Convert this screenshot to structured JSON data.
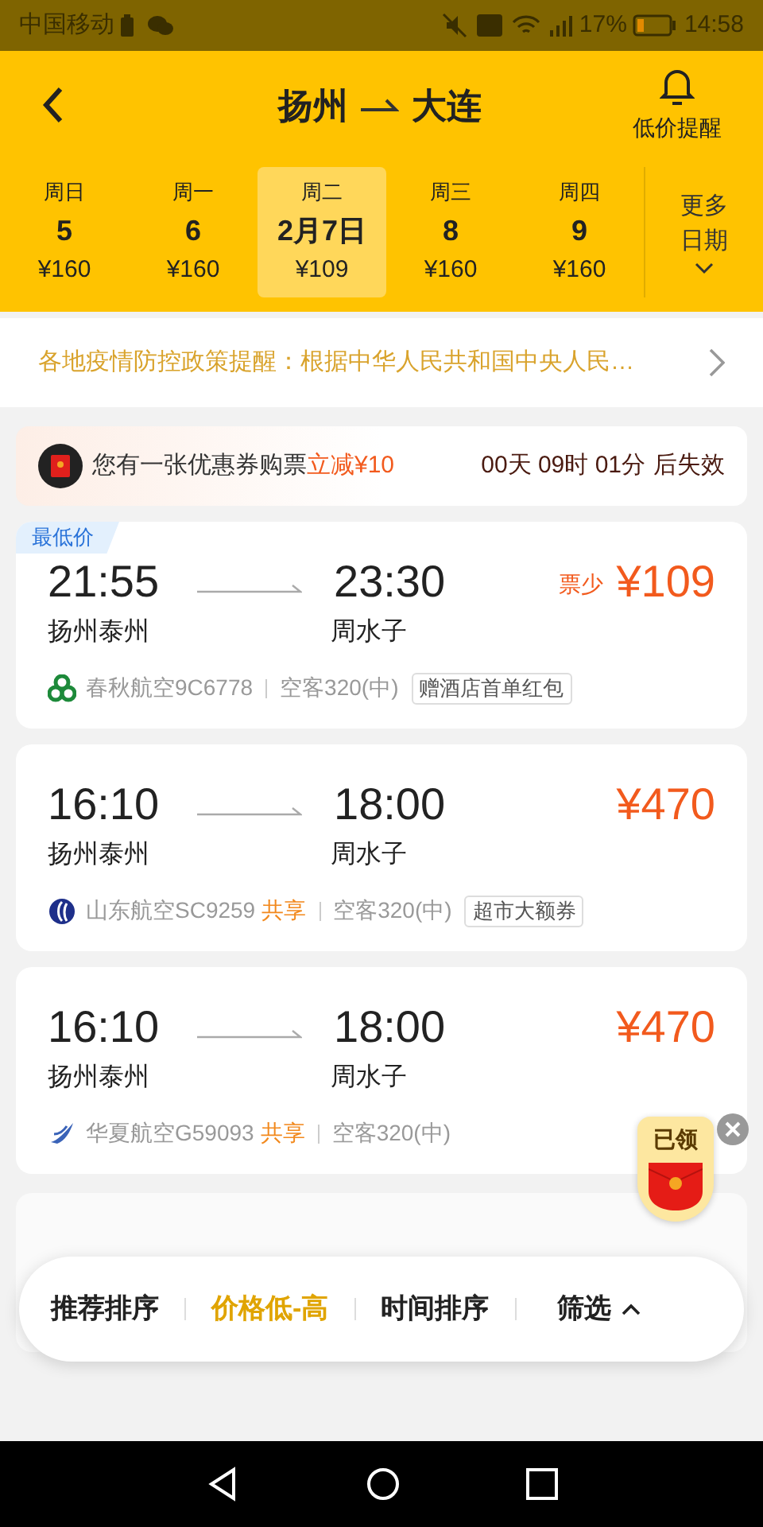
{
  "status_bar": {
    "carrier": "中国移动",
    "battery": "17%",
    "time": "14:58"
  },
  "header": {
    "from": "扬州",
    "to": "大连",
    "alert_label": "低价提醒"
  },
  "dates": [
    {
      "weekday": "周日",
      "day": "5",
      "price": "¥160",
      "selected": false
    },
    {
      "weekday": "周一",
      "day": "6",
      "price": "¥160",
      "selected": false
    },
    {
      "weekday": "周二",
      "day": "2月7日",
      "price": "¥109",
      "selected": true
    },
    {
      "weekday": "周三",
      "day": "8",
      "price": "¥160",
      "selected": false
    },
    {
      "weekday": "周四",
      "day": "9",
      "price": "¥160",
      "selected": false
    }
  ],
  "more_dates": "更多日期",
  "notice": "各地疫情防控政策提醒：根据中华人民共和国中央人民…",
  "coupon": {
    "text": "您有一张优惠券购票",
    "discount": "立减¥10",
    "countdown": "00天 09时 01分",
    "suffix": "后失效"
  },
  "flights": [
    {
      "badge": "最低价",
      "depart": "21:55",
      "arrive": "23:30",
      "from": "扬州泰州",
      "to": "周水子",
      "price_note": "票少",
      "price": "¥109",
      "kind": "spring",
      "flight": "春秋航空9C6778",
      "aircraft": "空客320(中)",
      "tag": "赠酒店首单红包"
    },
    {
      "depart": "16:10",
      "arrive": "18:00",
      "from": "扬州泰州",
      "to": "周水子",
      "price": "¥470",
      "kind": "shandong",
      "flight": "山东航空SC9259",
      "share": "共享",
      "aircraft": "空客320(中)",
      "tag": "超市大额券"
    },
    {
      "depart": "16:10",
      "arrive": "18:00",
      "from": "扬州泰州",
      "to": "周水子",
      "price": "¥470",
      "kind": "huaxia",
      "flight": "华夏航空G59093",
      "share": "共享",
      "aircraft": "空客320(中)"
    }
  ],
  "sort_options": [
    {
      "label": "推荐排序",
      "selected": false
    },
    {
      "label": "价格低-高",
      "selected": true
    },
    {
      "label": "时间排序",
      "selected": false
    }
  ],
  "filter_label": "筛选",
  "float_coupon": {
    "label": "已领"
  }
}
